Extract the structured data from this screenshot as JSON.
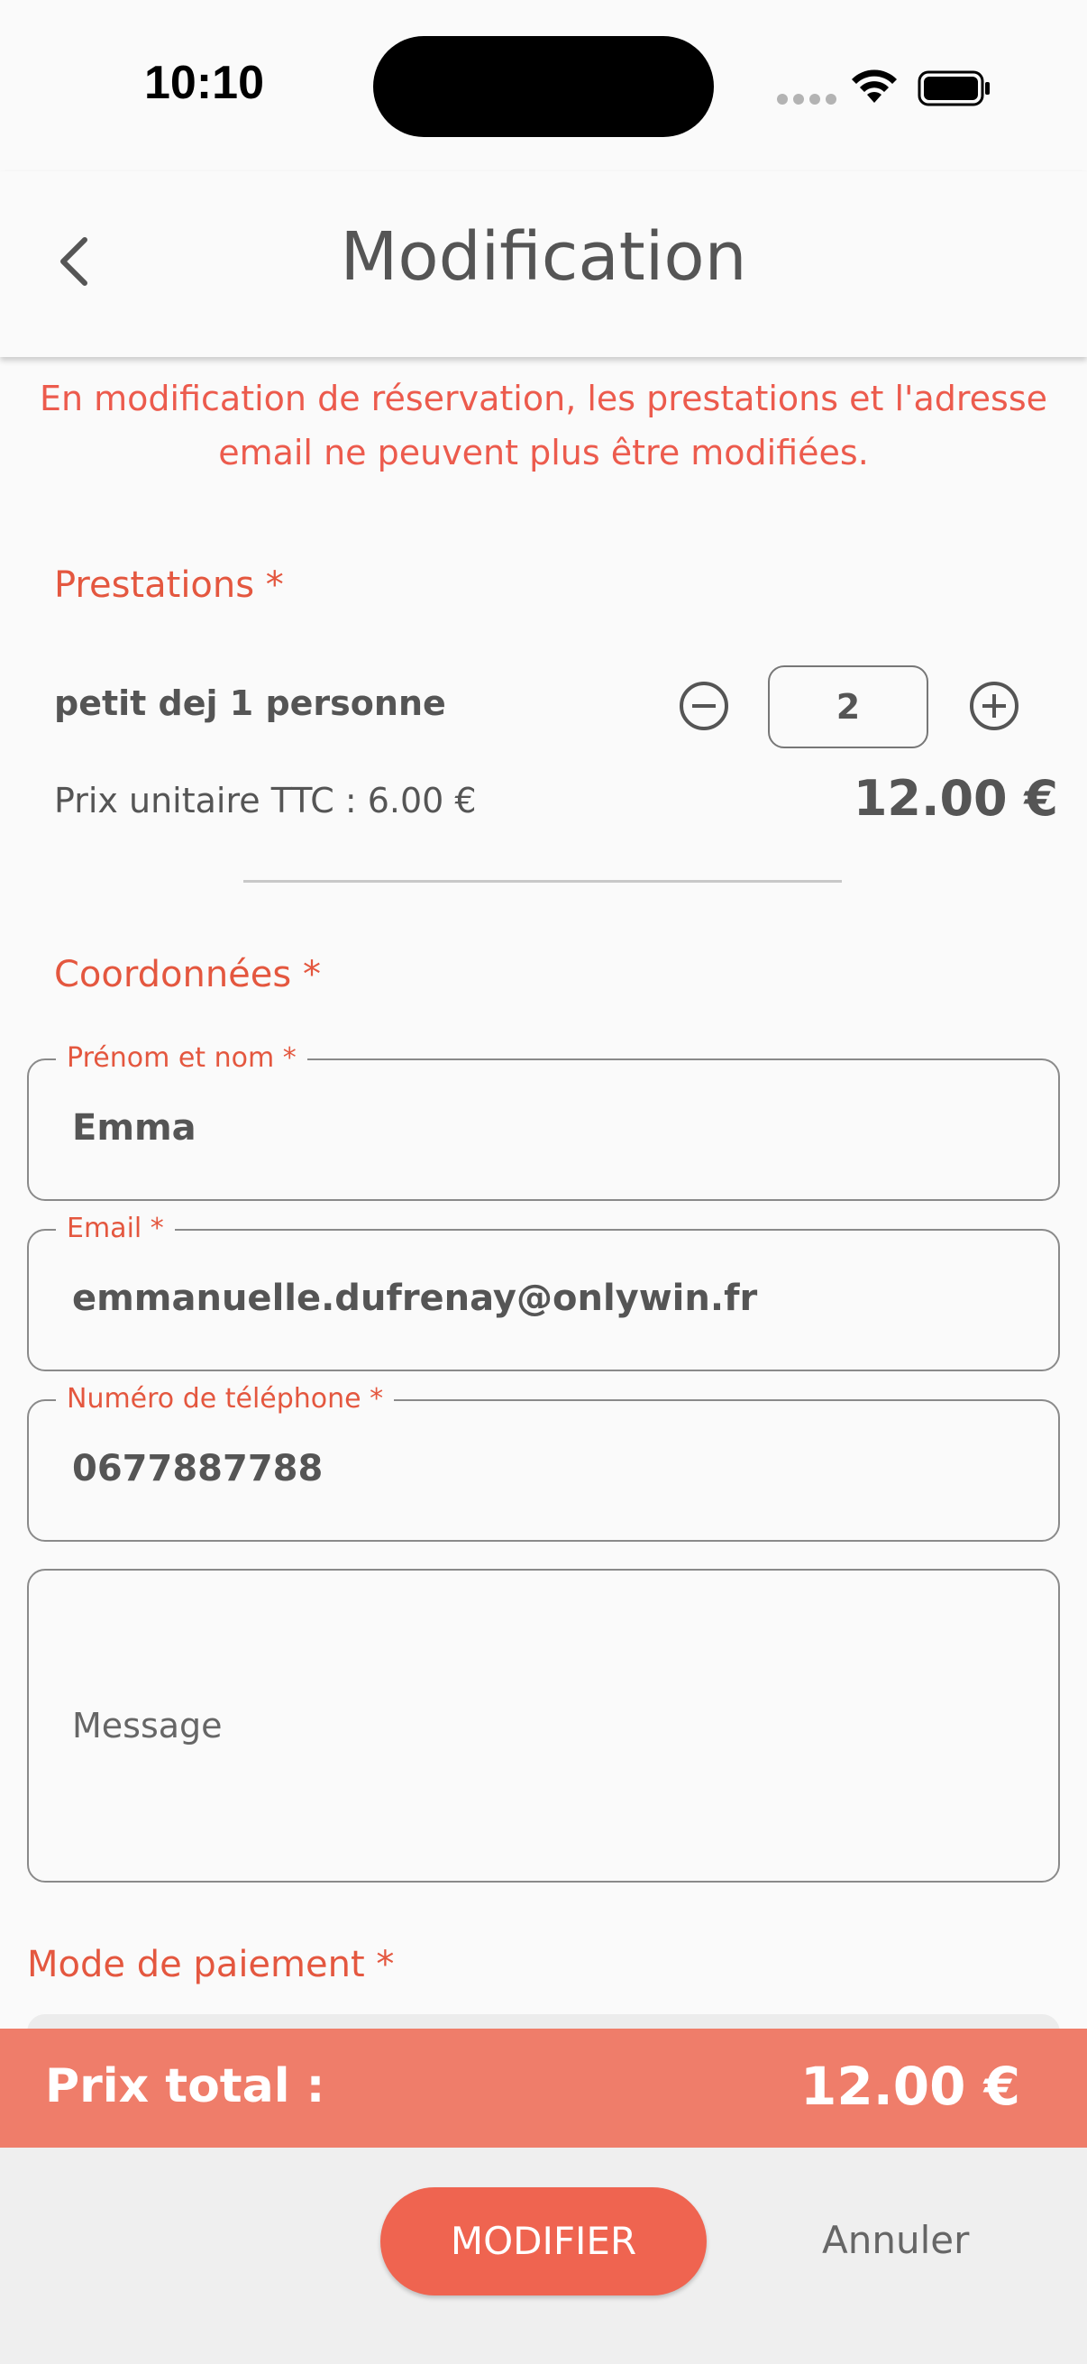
{
  "status_bar": {
    "time": "10:10"
  },
  "header": {
    "title": "Modification"
  },
  "warning": {
    "line1": "En modification de réservation, les prestations et l'adresse",
    "line2": "email ne peuvent plus être modifiées."
  },
  "prestations": {
    "section_title": "Prestations *",
    "items": [
      {
        "name": "petit dej 1 personne",
        "quantity": "2",
        "unit_price_label": "Prix unitaire TTC : 6.00 €",
        "line_total": "12.00 €"
      }
    ]
  },
  "coordonnees": {
    "section_title": "Coordonnées *",
    "name_field": {
      "label": "Prénom et nom *",
      "value": "Emma"
    },
    "email_field": {
      "label": "Email *",
      "value": "emmanuelle.dufrenay@onlywin.fr"
    },
    "phone_field": {
      "label": "Numéro de téléphone *",
      "value": "0677887788"
    },
    "message_field": {
      "placeholder": "Message"
    }
  },
  "payment": {
    "section_title": "Mode de paiement *"
  },
  "total": {
    "label": "Prix total :",
    "value": "12.00 €"
  },
  "actions": {
    "modify_label": "MODIFIER",
    "cancel_label": "Annuler"
  },
  "colors": {
    "accent": "#e4573f",
    "warning": "#ec5b4d",
    "total_bar": "#ef7d6a",
    "button": "#ef6450"
  }
}
